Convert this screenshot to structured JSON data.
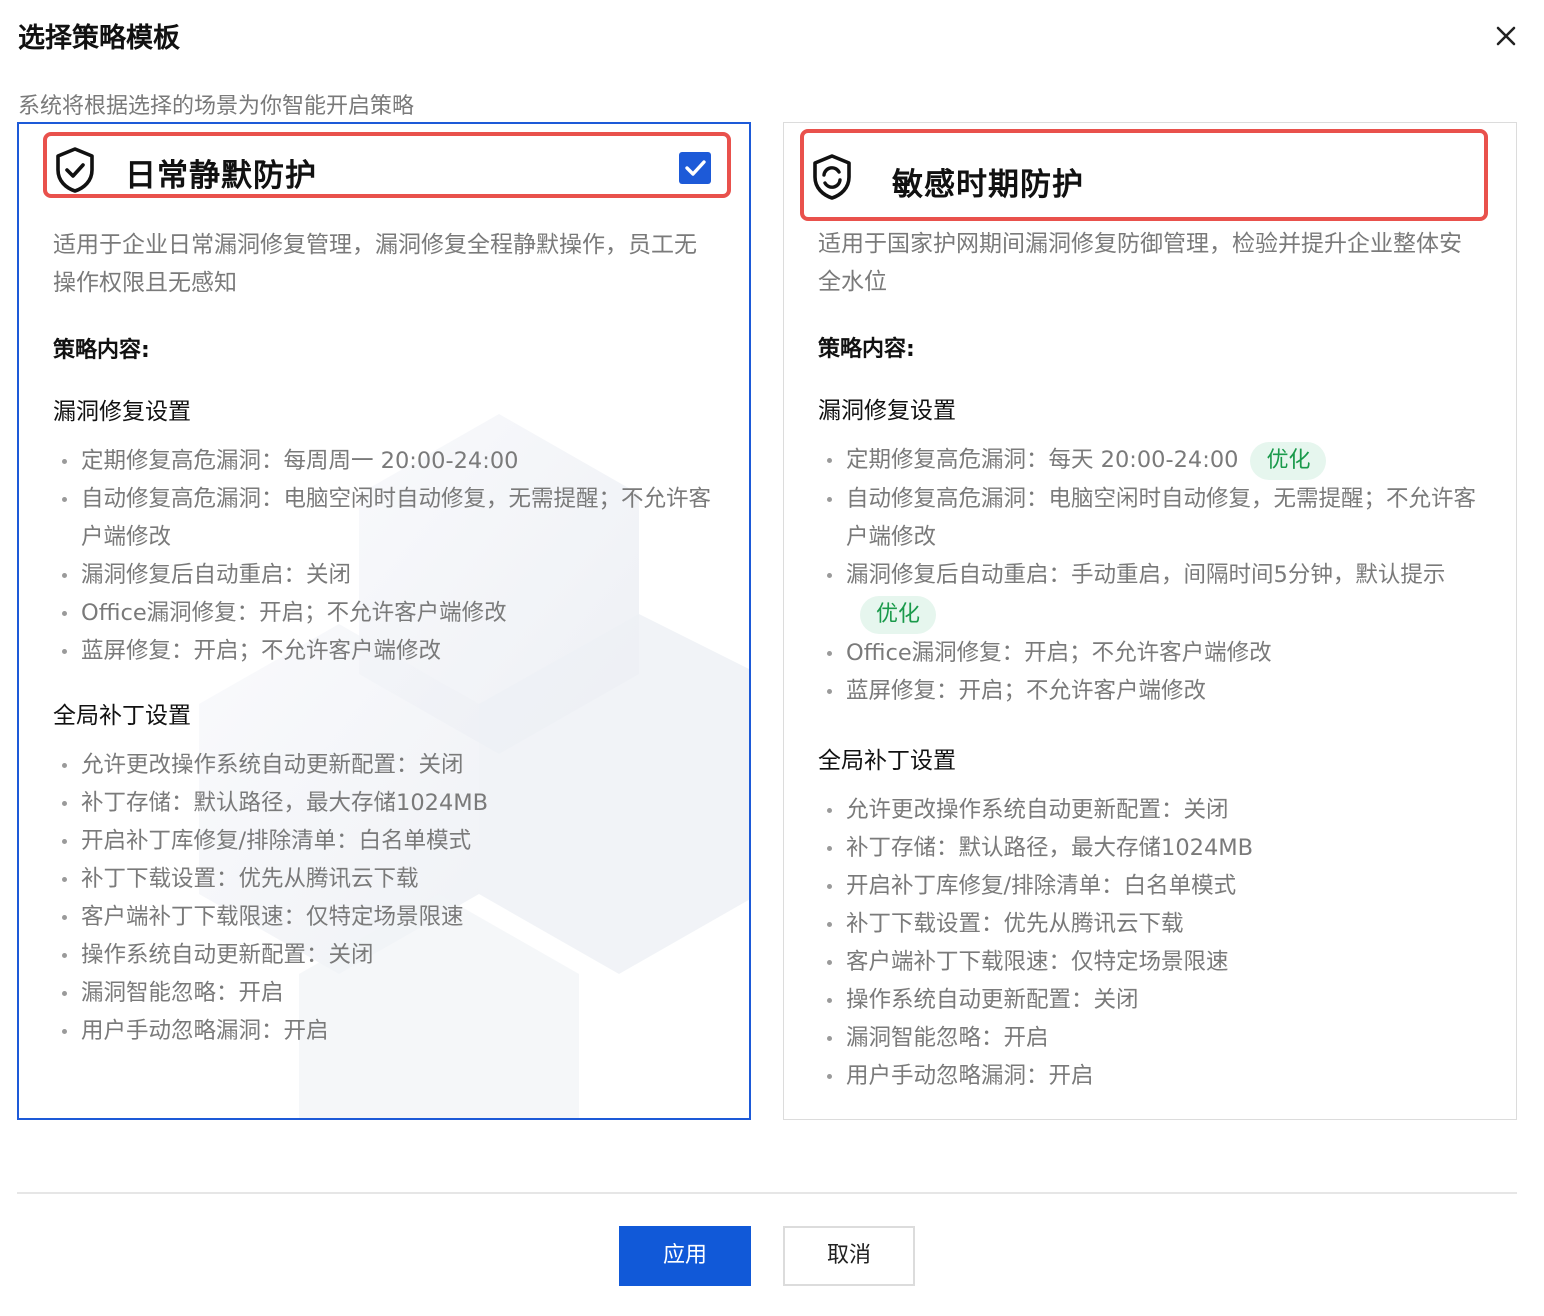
{
  "dialog": {
    "title": "选择策略模板",
    "subtitle": "系统将根据选择的场景为你智能开启策略"
  },
  "cards": [
    {
      "name": "日常静默防护",
      "selected": true,
      "description": "适用于企业日常漏洞修复管理，漏洞修复全程静默操作，员工无操作权限且无感知",
      "content_label": "策略内容:",
      "vuln_title": "漏洞修复设置",
      "vuln_items": [
        "定期修复高危漏洞：每周周一 20:00-24:00",
        "自动修复高危漏洞：电脑空闲时自动修复，无需提醒；不允许客户端修改",
        "漏洞修复后自动重启：关闭",
        "Office漏洞修复：开启；不允许客户端修改",
        "蓝屏修复：开启；不允许客户端修改"
      ],
      "patch_title": "全局补丁设置",
      "patch_items": [
        "允许更改操作系统自动更新配置：关闭",
        "补丁存储：默认路径，最大存储1024MB",
        "开启补丁库修复/排除清单：白名单模式",
        "补丁下载设置：优先从腾讯云下载",
        "客户端补丁下载限速：仅特定场景限速",
        "操作系统自动更新配置：关闭",
        "漏洞智能忽略：开启",
        "用户手动忽略漏洞：开启"
      ]
    },
    {
      "name": "敏感时期防护",
      "selected": false,
      "description": "适用于国家护网期间漏洞修复防御管理，检验并提升企业整体安全水位",
      "content_label": "策略内容:",
      "vuln_title": "漏洞修复设置",
      "vuln_items": [
        "定期修复高危漏洞：每天 20:00-24:00",
        "自动修复高危漏洞：电脑空闲时自动修复，无需提醒；不允许客户端修改",
        "漏洞修复后自动重启：手动重启，间隔时间5分钟，默认提示",
        "Office漏洞修复：开启；不允许客户端修改",
        "蓝屏修复：开启；不允许客户端修改"
      ],
      "badge": "优化",
      "patch_title": "全局补丁设置",
      "patch_items": [
        "允许更改操作系统自动更新配置：关闭",
        "补丁存储：默认路径，最大存储1024MB",
        "开启补丁库修复/排除清单：白名单模式",
        "补丁下载设置：优先从腾讯云下载",
        "客户端补丁下载限速：仅特定场景限速",
        "操作系统自动更新配置：关闭",
        "漏洞智能忽略：开启",
        "用户手动忽略漏洞：开启"
      ]
    }
  ],
  "footer": {
    "apply_label": "应用",
    "cancel_label": "取消"
  },
  "colors": {
    "primary": "#1159d8",
    "highlight_border": "#e9514c",
    "badge_bg": "#e6f6ee",
    "badge_text": "#1a9a4b"
  },
  "icons": {
    "close": "close-icon",
    "shield_check": "shield-check-icon",
    "shield_cycle": "shield-refresh-icon",
    "check": "check-icon"
  }
}
